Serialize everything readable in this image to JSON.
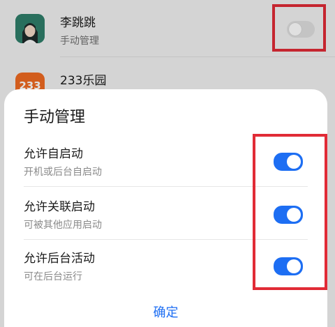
{
  "apps": [
    {
      "name": "李跳跳",
      "subtitle": "手动管理",
      "enabled": false
    },
    {
      "name": "233乐园",
      "badge": "233",
      "enabled": true
    }
  ],
  "dialog": {
    "title": "手动管理",
    "options": [
      {
        "label": "允许自启动",
        "description": "开机或后台自启动",
        "enabled": true
      },
      {
        "label": "允许关联启动",
        "description": "可被其他应用启动",
        "enabled": true
      },
      {
        "label": "允许后台活动",
        "description": "可在后台运行",
        "enabled": true
      }
    ],
    "confirm_label": "确定"
  },
  "colors": {
    "accent": "#1d6ef3",
    "highlight_box": "#e12b36",
    "toggle_off": "#e0e0e0"
  }
}
